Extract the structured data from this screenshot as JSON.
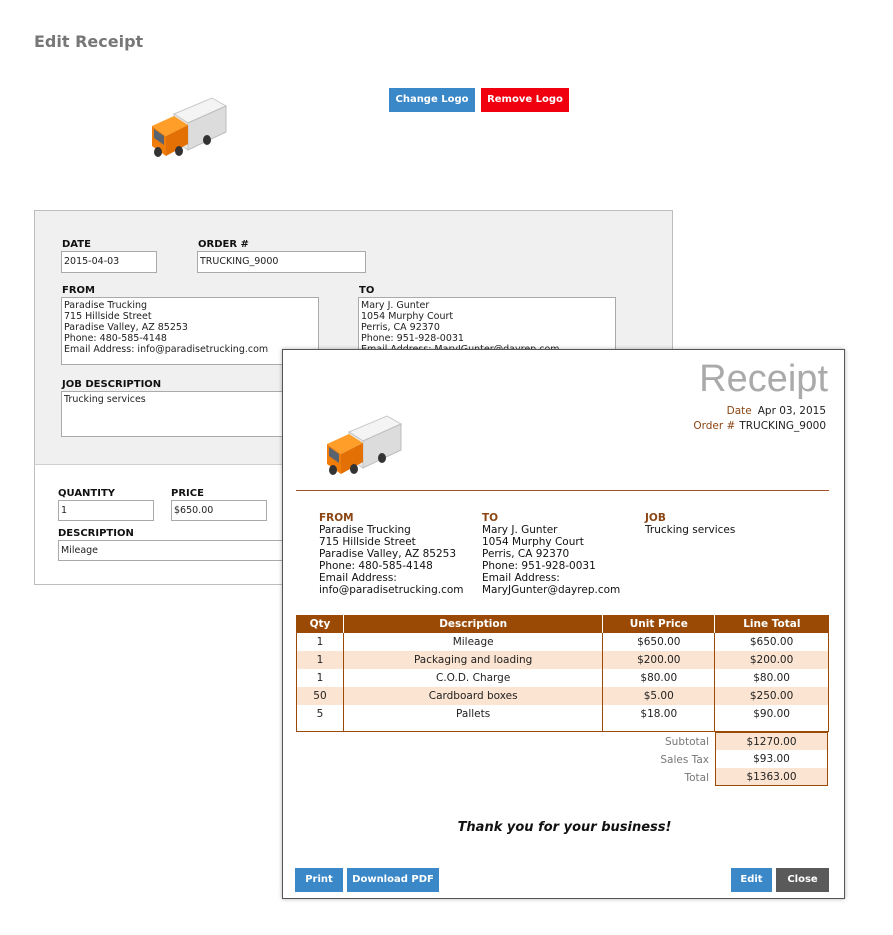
{
  "page": {
    "title": "Edit Receipt"
  },
  "logo_buttons": {
    "change": "Change Logo",
    "remove": "Remove Logo"
  },
  "form": {
    "date_label": "DATE",
    "date_value": "2015-04-03",
    "order_label": "ORDER #",
    "order_value": "TRUCKING_9000",
    "from_label": "FROM",
    "from_value": "Paradise Trucking\n715 Hillside Street\nParadise Valley, AZ 85253\nPhone: 480-585-4148\nEmail Address: info@paradisetrucking.com",
    "to_label": "TO",
    "to_value": "Mary J. Gunter\n1054 Murphy Court\nPerris, CA 92370\nPhone: 951-928-0031\nEmail Address: MaryJGunter@dayrep.com",
    "job_label": "JOB DESCRIPTION",
    "job_value": "Trucking services",
    "qty_label": "QUANTITY",
    "qty_value": "1",
    "price_label": "PRICE",
    "price_value": "$650.00",
    "desc_label": "DESCRIPTION",
    "desc_value": "Mileage"
  },
  "receipt": {
    "title": "Receipt",
    "date_label": "Date",
    "date_value": "Apr 03, 2015",
    "order_label": "Order #",
    "order_value": "TRUCKING_9000",
    "from_heading": "FROM",
    "from_lines": "Paradise Trucking\n715 Hillside Street\nParadise Valley, AZ 85253\nPhone: 480-585-4148\nEmail Address:\ninfo@paradisetrucking.com",
    "to_heading": "TO",
    "to_lines": "Mary J. Gunter\n1054 Murphy Court\nPerris, CA 92370\nPhone: 951-928-0031\nEmail Address:\nMaryJGunter@dayrep.com",
    "job_heading": "JOB",
    "job_text": "Trucking services",
    "columns": [
      "Qty",
      "Description",
      "Unit Price",
      "Line Total"
    ],
    "items": [
      {
        "qty": "1",
        "desc": "Mileage",
        "unit": "$650.00",
        "total": "$650.00"
      },
      {
        "qty": "1",
        "desc": "Packaging and loading",
        "unit": "$200.00",
        "total": "$200.00"
      },
      {
        "qty": "1",
        "desc": "C.O.D. Charge",
        "unit": "$80.00",
        "total": "$80.00"
      },
      {
        "qty": "50",
        "desc": "Cardboard boxes",
        "unit": "$5.00",
        "total": "$250.00"
      },
      {
        "qty": "5",
        "desc": "Pallets",
        "unit": "$18.00",
        "total": "$90.00"
      }
    ],
    "subtotal_label": "Subtotal",
    "subtotal_value": "$1270.00",
    "tax_label": "Sales Tax",
    "tax_value": "$93.00",
    "total_label": "Total",
    "total_value": "$1363.00",
    "thanks": "Thank you for your business!",
    "buttons": {
      "print": "Print",
      "pdf": "Download PDF",
      "edit": "Edit",
      "close": "Close"
    }
  },
  "colors": {
    "accent_brown": "#9b4a05",
    "button_blue": "#3b88c8",
    "button_red": "#f0000f",
    "row_alt": "#fbe4d1"
  },
  "icons": {
    "logo": "delivery-truck-icon"
  }
}
